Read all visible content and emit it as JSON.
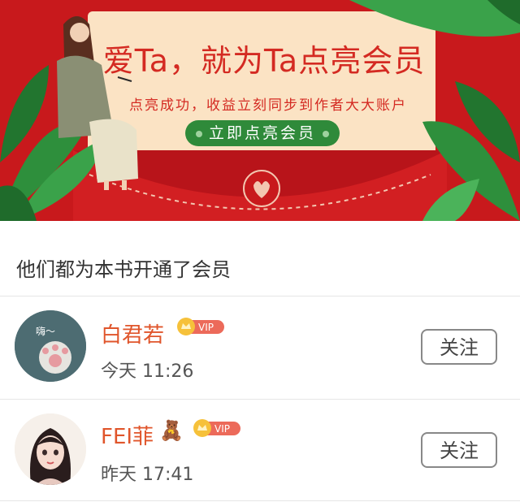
{
  "banner": {
    "title": "爱Ta，就为Ta点亮会员",
    "subtitle": "点亮成功，收益立刻同步到作者大大账户",
    "button_label": "立即点亮会员"
  },
  "section_title": "他们都为本书开通了会员",
  "members": [
    {
      "name": "白君若",
      "badge": "VIP",
      "time": "今天 11:26",
      "follow_label": "关注",
      "avatar_text": "嗨～"
    },
    {
      "name": "FEI菲",
      "emoji": "🧸",
      "badge": "VIP",
      "time": "昨天 17:41",
      "follow_label": "关注"
    }
  ],
  "colors": {
    "banner_red": "#c8191c",
    "accent_green": "#2f8a3a",
    "name_orange": "#e0552b"
  }
}
